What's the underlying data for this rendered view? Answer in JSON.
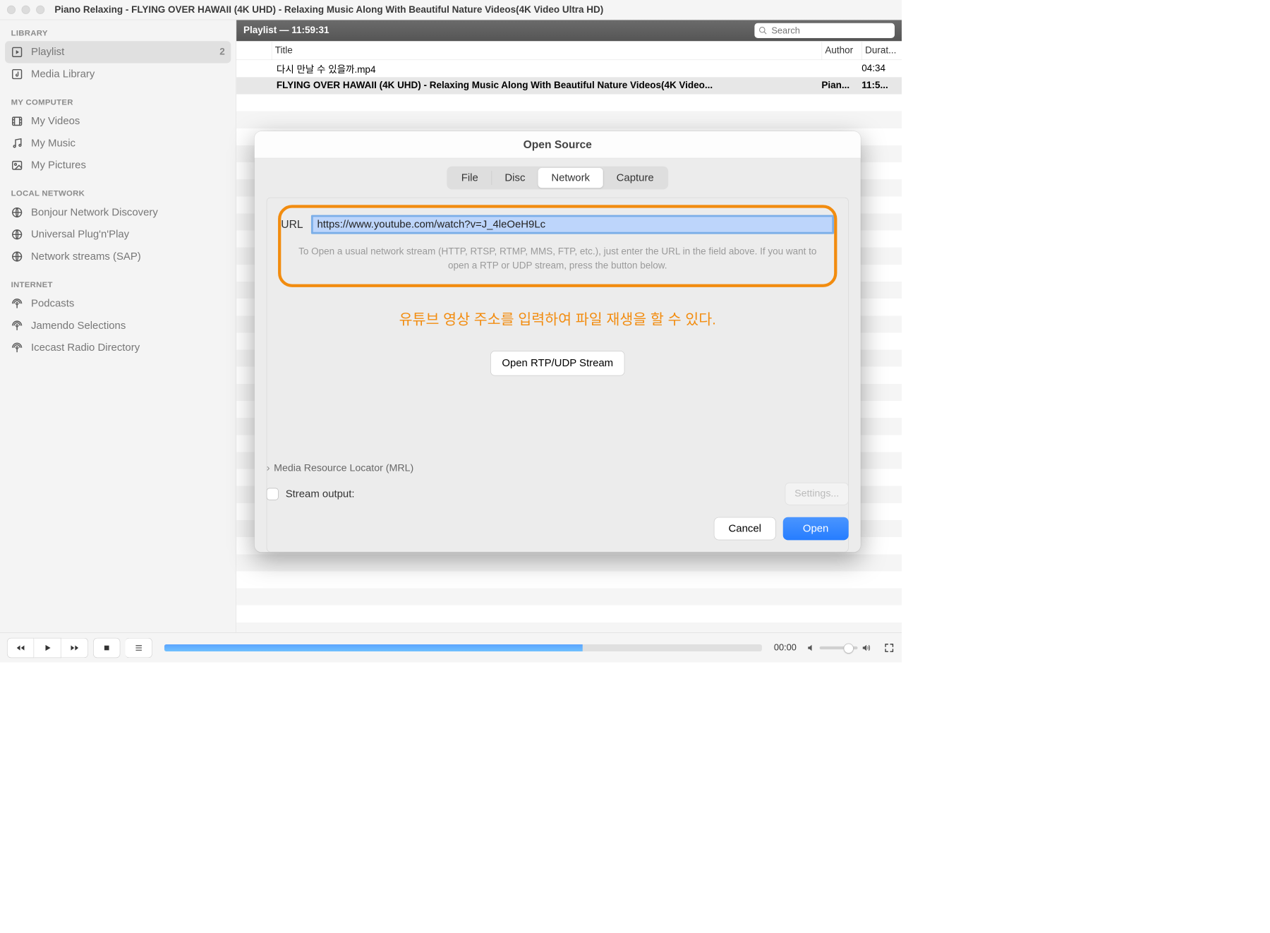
{
  "window": {
    "title": "Piano Relaxing - FLYING OVER HAWAII (4K UHD) - Relaxing Music Along With Beautiful Nature Videos(4K Video Ultra HD)"
  },
  "sidebar": {
    "sections": [
      {
        "title": "LIBRARY",
        "items": [
          {
            "name": "playlist",
            "label": "Playlist",
            "count": "2",
            "selected": true
          },
          {
            "name": "media-library",
            "label": "Media Library"
          }
        ]
      },
      {
        "title": "MY COMPUTER",
        "items": [
          {
            "name": "my-videos",
            "label": "My Videos"
          },
          {
            "name": "my-music",
            "label": "My Music"
          },
          {
            "name": "my-pictures",
            "label": "My Pictures"
          }
        ]
      },
      {
        "title": "LOCAL NETWORK",
        "items": [
          {
            "name": "bonjour",
            "label": "Bonjour Network Discovery"
          },
          {
            "name": "upnp",
            "label": "Universal Plug'n'Play"
          },
          {
            "name": "sap",
            "label": "Network streams (SAP)"
          }
        ]
      },
      {
        "title": "INTERNET",
        "items": [
          {
            "name": "podcasts",
            "label": "Podcasts"
          },
          {
            "name": "jamendo",
            "label": "Jamendo Selections"
          },
          {
            "name": "icecast",
            "label": "Icecast Radio Directory"
          }
        ]
      }
    ]
  },
  "content_header": {
    "title": "Playlist — 11:59:31",
    "search_placeholder": "Search"
  },
  "table": {
    "headers": {
      "title": "Title",
      "author": "Author",
      "duration": "Durat..."
    },
    "rows": [
      {
        "title": "다시 만날 수 있을까.mp4",
        "author": "",
        "duration": "04:34",
        "selected": false
      },
      {
        "title": "FLYING OVER HAWAII (4K UHD) - Relaxing Music Along With Beautiful Nature Videos(4K Video...",
        "author": "Pian...",
        "duration": "11:5...",
        "selected": true
      }
    ]
  },
  "dialog": {
    "title": "Open Source",
    "tabs": {
      "file": "File",
      "disc": "Disc",
      "network": "Network",
      "capture": "Capture"
    },
    "url_label": "URL",
    "url_value": "https://www.youtube.com/watch?v=J_4leOeH9Lc",
    "hint": "To Open a usual network stream (HTTP, RTSP, RTMP, MMS, FTP, etc.), just enter the URL in the field above. If you want to open a RTP or UDP stream, press the button below.",
    "annotation": "유튜브 영상 주소를 입력하여 파일 재생을 할 수 있다.",
    "rtp_button": "Open RTP/UDP Stream",
    "mrl_label": "Media Resource Locator (MRL)",
    "stream_output_label": "Stream output:",
    "settings_button": "Settings...",
    "cancel": "Cancel",
    "open": "Open"
  },
  "controls": {
    "time": "00:00"
  }
}
